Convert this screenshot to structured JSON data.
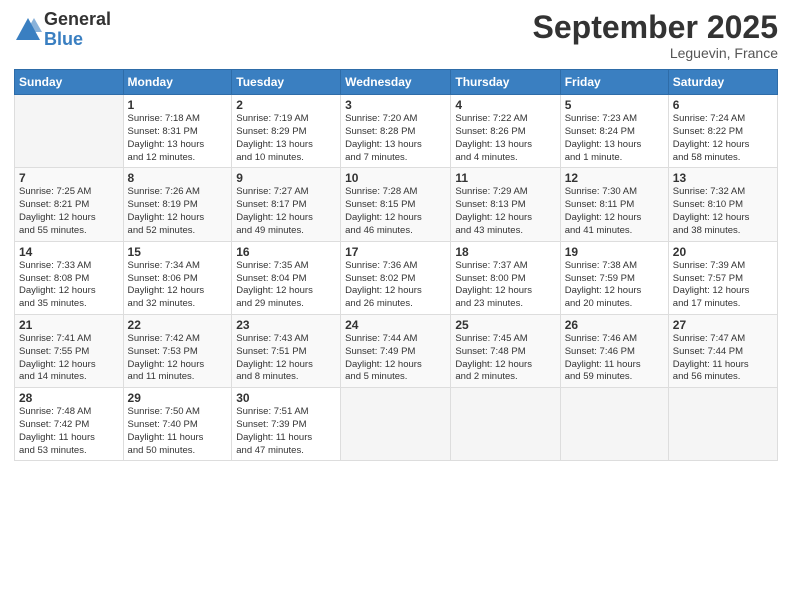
{
  "header": {
    "logo_general": "General",
    "logo_blue": "Blue",
    "title": "September 2025",
    "subtitle": "Leguevin, France"
  },
  "days_of_week": [
    "Sunday",
    "Monday",
    "Tuesday",
    "Wednesday",
    "Thursday",
    "Friday",
    "Saturday"
  ],
  "weeks": [
    [
      {
        "num": "",
        "info": ""
      },
      {
        "num": "1",
        "info": "Sunrise: 7:18 AM\nSunset: 8:31 PM\nDaylight: 13 hours\nand 12 minutes."
      },
      {
        "num": "2",
        "info": "Sunrise: 7:19 AM\nSunset: 8:29 PM\nDaylight: 13 hours\nand 10 minutes."
      },
      {
        "num": "3",
        "info": "Sunrise: 7:20 AM\nSunset: 8:28 PM\nDaylight: 13 hours\nand 7 minutes."
      },
      {
        "num": "4",
        "info": "Sunrise: 7:22 AM\nSunset: 8:26 PM\nDaylight: 13 hours\nand 4 minutes."
      },
      {
        "num": "5",
        "info": "Sunrise: 7:23 AM\nSunset: 8:24 PM\nDaylight: 13 hours\nand 1 minute."
      },
      {
        "num": "6",
        "info": "Sunrise: 7:24 AM\nSunset: 8:22 PM\nDaylight: 12 hours\nand 58 minutes."
      }
    ],
    [
      {
        "num": "7",
        "info": "Sunrise: 7:25 AM\nSunset: 8:21 PM\nDaylight: 12 hours\nand 55 minutes."
      },
      {
        "num": "8",
        "info": "Sunrise: 7:26 AM\nSunset: 8:19 PM\nDaylight: 12 hours\nand 52 minutes."
      },
      {
        "num": "9",
        "info": "Sunrise: 7:27 AM\nSunset: 8:17 PM\nDaylight: 12 hours\nand 49 minutes."
      },
      {
        "num": "10",
        "info": "Sunrise: 7:28 AM\nSunset: 8:15 PM\nDaylight: 12 hours\nand 46 minutes."
      },
      {
        "num": "11",
        "info": "Sunrise: 7:29 AM\nSunset: 8:13 PM\nDaylight: 12 hours\nand 43 minutes."
      },
      {
        "num": "12",
        "info": "Sunrise: 7:30 AM\nSunset: 8:11 PM\nDaylight: 12 hours\nand 41 minutes."
      },
      {
        "num": "13",
        "info": "Sunrise: 7:32 AM\nSunset: 8:10 PM\nDaylight: 12 hours\nand 38 minutes."
      }
    ],
    [
      {
        "num": "14",
        "info": "Sunrise: 7:33 AM\nSunset: 8:08 PM\nDaylight: 12 hours\nand 35 minutes."
      },
      {
        "num": "15",
        "info": "Sunrise: 7:34 AM\nSunset: 8:06 PM\nDaylight: 12 hours\nand 32 minutes."
      },
      {
        "num": "16",
        "info": "Sunrise: 7:35 AM\nSunset: 8:04 PM\nDaylight: 12 hours\nand 29 minutes."
      },
      {
        "num": "17",
        "info": "Sunrise: 7:36 AM\nSunset: 8:02 PM\nDaylight: 12 hours\nand 26 minutes."
      },
      {
        "num": "18",
        "info": "Sunrise: 7:37 AM\nSunset: 8:00 PM\nDaylight: 12 hours\nand 23 minutes."
      },
      {
        "num": "19",
        "info": "Sunrise: 7:38 AM\nSunset: 7:59 PM\nDaylight: 12 hours\nand 20 minutes."
      },
      {
        "num": "20",
        "info": "Sunrise: 7:39 AM\nSunset: 7:57 PM\nDaylight: 12 hours\nand 17 minutes."
      }
    ],
    [
      {
        "num": "21",
        "info": "Sunrise: 7:41 AM\nSunset: 7:55 PM\nDaylight: 12 hours\nand 14 minutes."
      },
      {
        "num": "22",
        "info": "Sunrise: 7:42 AM\nSunset: 7:53 PM\nDaylight: 12 hours\nand 11 minutes."
      },
      {
        "num": "23",
        "info": "Sunrise: 7:43 AM\nSunset: 7:51 PM\nDaylight: 12 hours\nand 8 minutes."
      },
      {
        "num": "24",
        "info": "Sunrise: 7:44 AM\nSunset: 7:49 PM\nDaylight: 12 hours\nand 5 minutes."
      },
      {
        "num": "25",
        "info": "Sunrise: 7:45 AM\nSunset: 7:48 PM\nDaylight: 12 hours\nand 2 minutes."
      },
      {
        "num": "26",
        "info": "Sunrise: 7:46 AM\nSunset: 7:46 PM\nDaylight: 11 hours\nand 59 minutes."
      },
      {
        "num": "27",
        "info": "Sunrise: 7:47 AM\nSunset: 7:44 PM\nDaylight: 11 hours\nand 56 minutes."
      }
    ],
    [
      {
        "num": "28",
        "info": "Sunrise: 7:48 AM\nSunset: 7:42 PM\nDaylight: 11 hours\nand 53 minutes."
      },
      {
        "num": "29",
        "info": "Sunrise: 7:50 AM\nSunset: 7:40 PM\nDaylight: 11 hours\nand 50 minutes."
      },
      {
        "num": "30",
        "info": "Sunrise: 7:51 AM\nSunset: 7:39 PM\nDaylight: 11 hours\nand 47 minutes."
      },
      {
        "num": "",
        "info": ""
      },
      {
        "num": "",
        "info": ""
      },
      {
        "num": "",
        "info": ""
      },
      {
        "num": "",
        "info": ""
      }
    ]
  ]
}
